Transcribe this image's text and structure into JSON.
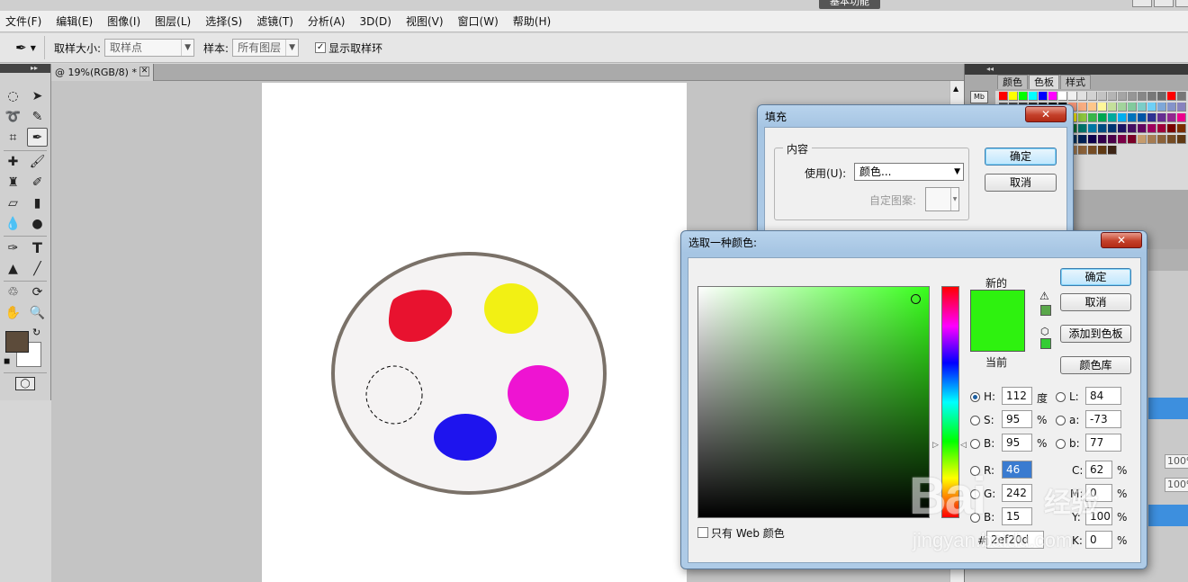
{
  "menubar": [
    "文件(F)",
    "编辑(E)",
    "图像(I)",
    "图层(L)",
    "选择(S)",
    "滤镜(T)",
    "分析(A)",
    "3D(D)",
    "视图(V)",
    "窗口(W)",
    "帮助(H)"
  ],
  "workspace": {
    "active": "基本功能"
  },
  "options": {
    "sample_size_label": "取样大小:",
    "sample_size_value": "取样点",
    "sample_label": "样本:",
    "sample_value": "所有图层",
    "show_ring_label": "显示取样环",
    "show_ring_checked": true
  },
  "document": {
    "tab_title": "@ 19%(RGB/8) *",
    "close_glyph": "✕"
  },
  "canvas": {
    "palette_border": "#7a7168",
    "palette_fill": "#f5f3f3",
    "blobs": [
      {
        "name": "red-paint",
        "color": "#e8122f"
      },
      {
        "name": "yellow-paint",
        "color": "#f2f014"
      },
      {
        "name": "magenta-paint",
        "color": "#ee14d2"
      },
      {
        "name": "blue-paint",
        "color": "#1e14ee"
      }
    ]
  },
  "right_panel": {
    "tabs": [
      "颜色",
      "色板",
      "样式"
    ],
    "active_tab": "色板",
    "opacity_values": [
      "100%",
      "100%"
    ]
  },
  "fill_dialog": {
    "title": "填充",
    "close": "✕",
    "group_label": "内容",
    "use_label": "使用(U):",
    "use_value": "颜色...",
    "pattern_label": "自定图案:",
    "ok": "确定",
    "cancel": "取消"
  },
  "color_picker": {
    "title": "选取一种颜色:",
    "close": "✕",
    "new_label": "新的",
    "current_label": "当前",
    "new_color": "#2ef20f",
    "current_color": "#2ef20f",
    "ok": "确定",
    "cancel": "取消",
    "add_swatch": "添加到色板",
    "library": "颜色库",
    "fields": {
      "H": {
        "label": "H:",
        "value": "112",
        "unit": "度"
      },
      "S": {
        "label": "S:",
        "value": "95",
        "unit": "%"
      },
      "B": {
        "label": "B:",
        "value": "95",
        "unit": "%"
      },
      "R": {
        "label": "R:",
        "value": "46"
      },
      "G": {
        "label": "G:",
        "value": "242"
      },
      "Bl": {
        "label": "B:",
        "value": "15"
      },
      "L": {
        "label": "L:",
        "value": "84"
      },
      "a": {
        "label": "a:",
        "value": "-73"
      },
      "b": {
        "label": "b:",
        "value": "77"
      },
      "C": {
        "label": "C:",
        "value": "62",
        "unit": "%"
      },
      "M": {
        "label": "M:",
        "value": "0",
        "unit": "%"
      },
      "Y": {
        "label": "Y:",
        "value": "100",
        "unit": "%"
      },
      "K": {
        "label": "K:",
        "value": "0",
        "unit": "%"
      },
      "hex": {
        "label": "#",
        "value": "2ef20d"
      }
    },
    "web_only_label": "只有 Web 颜色"
  },
  "watermark": {
    "logo": "Bai",
    "cn": "经验",
    "url": "jingyan.baidu.com"
  }
}
